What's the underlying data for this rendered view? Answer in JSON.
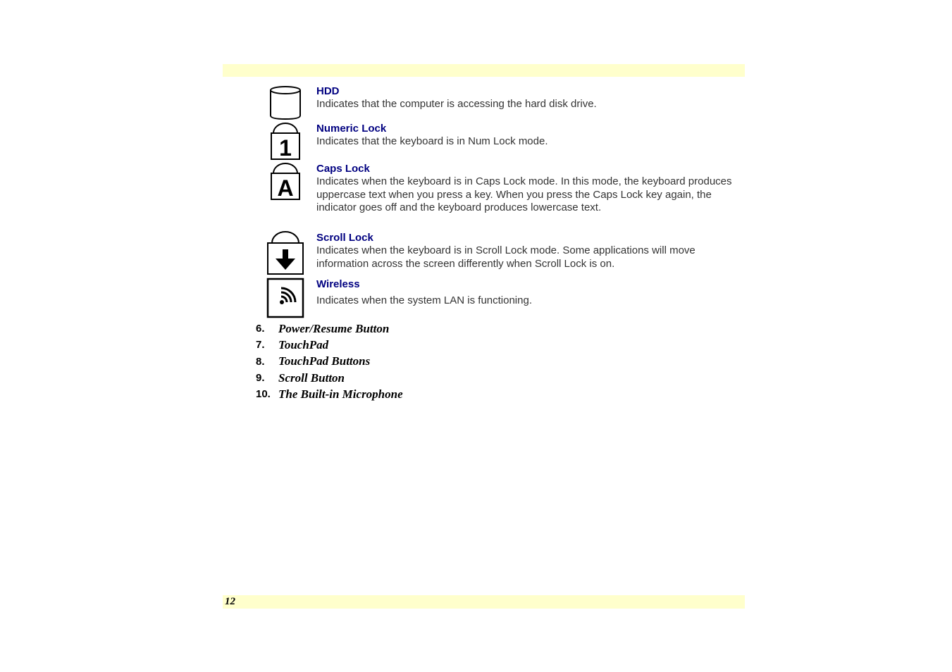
{
  "page": {
    "page_number": "12"
  },
  "indicators": [
    {
      "icon": "hdd-icon",
      "title": "HDD",
      "description": "Indicates that the computer is accessing the hard disk drive."
    },
    {
      "icon": "numeric-lock-icon",
      "title": "Numeric Lock",
      "description": "Indicates that the keyboard is in Num Lock mode."
    },
    {
      "icon": "caps-lock-icon",
      "title": "Caps Lock",
      "description": "Indicates when the keyboard is in Caps Lock mode.  In this mode, the keyboard produces uppercase text when you press a key.  When you press the Caps Lock key again, the indicator goes off and the keyboard produces lowercase text."
    },
    {
      "icon": "scroll-lock-icon",
      "title": "Scroll Lock",
      "description": "Indicates when the keyboard is in Scroll Lock mode.  Some applications will move information across the screen differently when Scroll Lock is on."
    },
    {
      "icon": "wireless-icon",
      "title": "Wireless",
      "description": "Indicates when the system LAN is functioning."
    }
  ],
  "icon_glyphs": {
    "numeric_lock": "1",
    "caps_lock": "A"
  },
  "list": [
    {
      "number": "6.",
      "label": "Power/Resume Button"
    },
    {
      "number": "7.",
      "label": "TouchPad"
    },
    {
      "number": "8.",
      "label": "TouchPad Buttons"
    },
    {
      "number": "9.",
      "label": "Scroll Button"
    },
    {
      "number": "10.",
      "label": "The Built-in Microphone"
    }
  ]
}
